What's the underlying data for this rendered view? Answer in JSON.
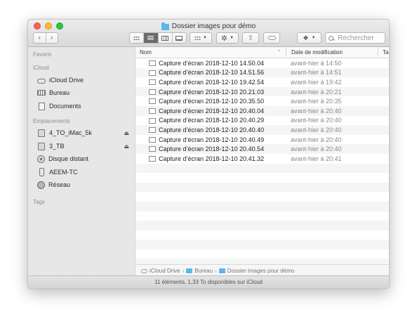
{
  "window": {
    "title": "Dossier images pour démo"
  },
  "toolbar": {
    "back_icon": "‹",
    "forward_icon": "›",
    "search_placeholder": "Rechercher",
    "icons": [
      "icon-view",
      "list-view",
      "column-view",
      "gallery-view",
      "group-menu",
      "action-menu",
      "share",
      "tags",
      "dropbox"
    ]
  },
  "sidebar": {
    "favorites_header": "Favoris",
    "icloud_header": "iCloud",
    "icloud_items": [
      {
        "label": "iCloud Drive",
        "icon": "cloud-icon"
      },
      {
        "label": "Bureau",
        "icon": "desktop-icon"
      },
      {
        "label": "Documents",
        "icon": "documents-icon"
      }
    ],
    "locations_header": "Emplacements",
    "location_items": [
      {
        "label": "4_TO_iMac_5k",
        "icon": "drive-icon",
        "eject": "⏏"
      },
      {
        "label": "3_TB",
        "icon": "drive-icon",
        "eject": "⏏"
      },
      {
        "label": "Disque distant",
        "icon": "disc-icon"
      },
      {
        "label": "AEEM-TC",
        "icon": "phone-icon"
      },
      {
        "label": "Réseau",
        "icon": "network-icon"
      }
    ],
    "tags_header": "Tags"
  },
  "columns": {
    "name": "Nom",
    "date": "Date de modification",
    "kind": "Ta",
    "sort_caret": "^"
  },
  "files": [
    {
      "name": "Capture d’écran 2018-12-10 14.50.04",
      "date": "avant-hier à 14:50"
    },
    {
      "name": "Capture d’écran 2018-12-10 14.51.56",
      "date": "avant-hier à 14:51"
    },
    {
      "name": "Capture d’écran 2018-12-10 19.42.54",
      "date": "avant-hier à 19:42"
    },
    {
      "name": "Capture d’écran 2018-12-10 20.21.03",
      "date": "avant-hier à 20:21"
    },
    {
      "name": "Capture d’écran 2018-12-10 20.35.50",
      "date": "avant-hier à 20:35"
    },
    {
      "name": "Capture d’écran 2018-12-10 20.40.04",
      "date": "avant-hier à 20:40"
    },
    {
      "name": "Capture d’écran 2018-12-10 20.40.29",
      "date": "avant-hier à 20:40"
    },
    {
      "name": "Capture d’écran 2018-12-10 20.40.40",
      "date": "avant-hier à 20:40"
    },
    {
      "name": "Capture d’écran 2018-12-10 20.40.49",
      "date": "avant-hier à 20:40"
    },
    {
      "name": "Capture d’écran 2018-12-10 20.40.54",
      "date": "avant-hier à 20:40"
    },
    {
      "name": "Capture d’écran 2018-12-10 20.41.32",
      "date": "avant-hier à 20:41"
    }
  ],
  "pathbar": {
    "items": [
      "iCloud Drive",
      "Bureau",
      "Dossier images pour démo"
    ],
    "separator": "›"
  },
  "status": {
    "text": "11 éléments, 1,33 To disponibles sur iCloud"
  }
}
